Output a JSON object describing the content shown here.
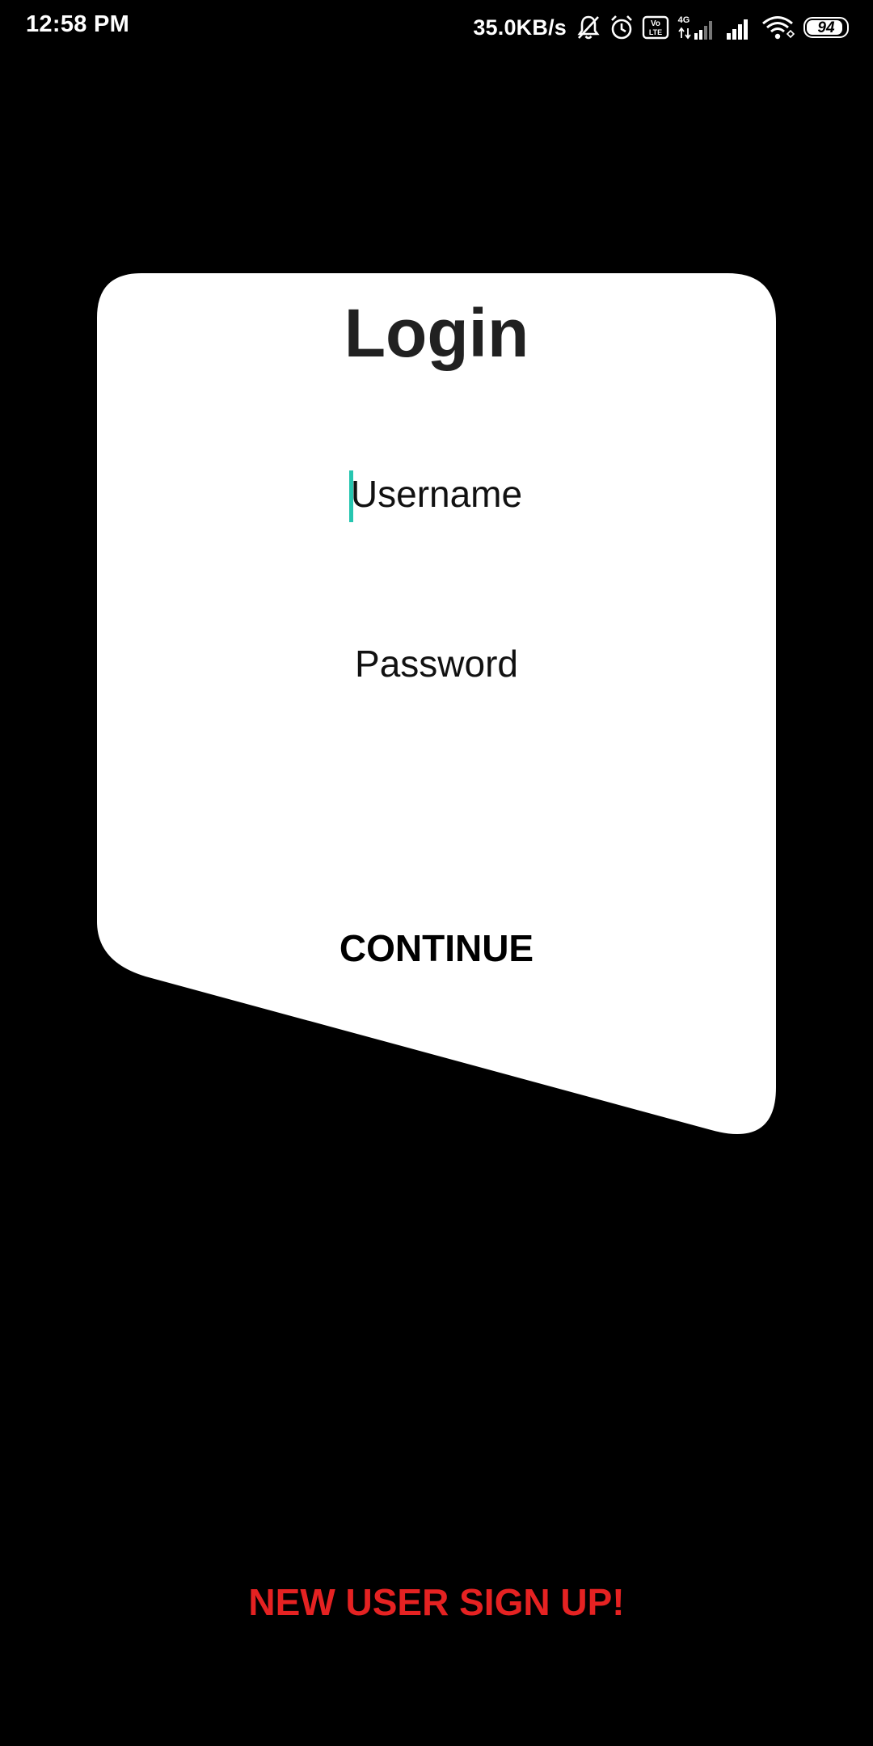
{
  "status_bar": {
    "time": "12:58 PM",
    "net_speed": "35.0KB/s",
    "battery_level": "94",
    "icons": [
      "bell-muted-icon",
      "alarm-icon",
      "volte-icon",
      "signal-4g-icon",
      "signal-icon",
      "wifi-icon",
      "battery-icon"
    ]
  },
  "login": {
    "title": "Login",
    "username_placeholder": "Username",
    "password_placeholder": "Password",
    "continue_label": "CONTINUE"
  },
  "signup": {
    "label": "NEW USER SIGN UP!"
  },
  "colors": {
    "background": "#000000",
    "card": "#ffffff",
    "cursor_accent": "#26c6b0",
    "signup_text": "#e52222"
  }
}
